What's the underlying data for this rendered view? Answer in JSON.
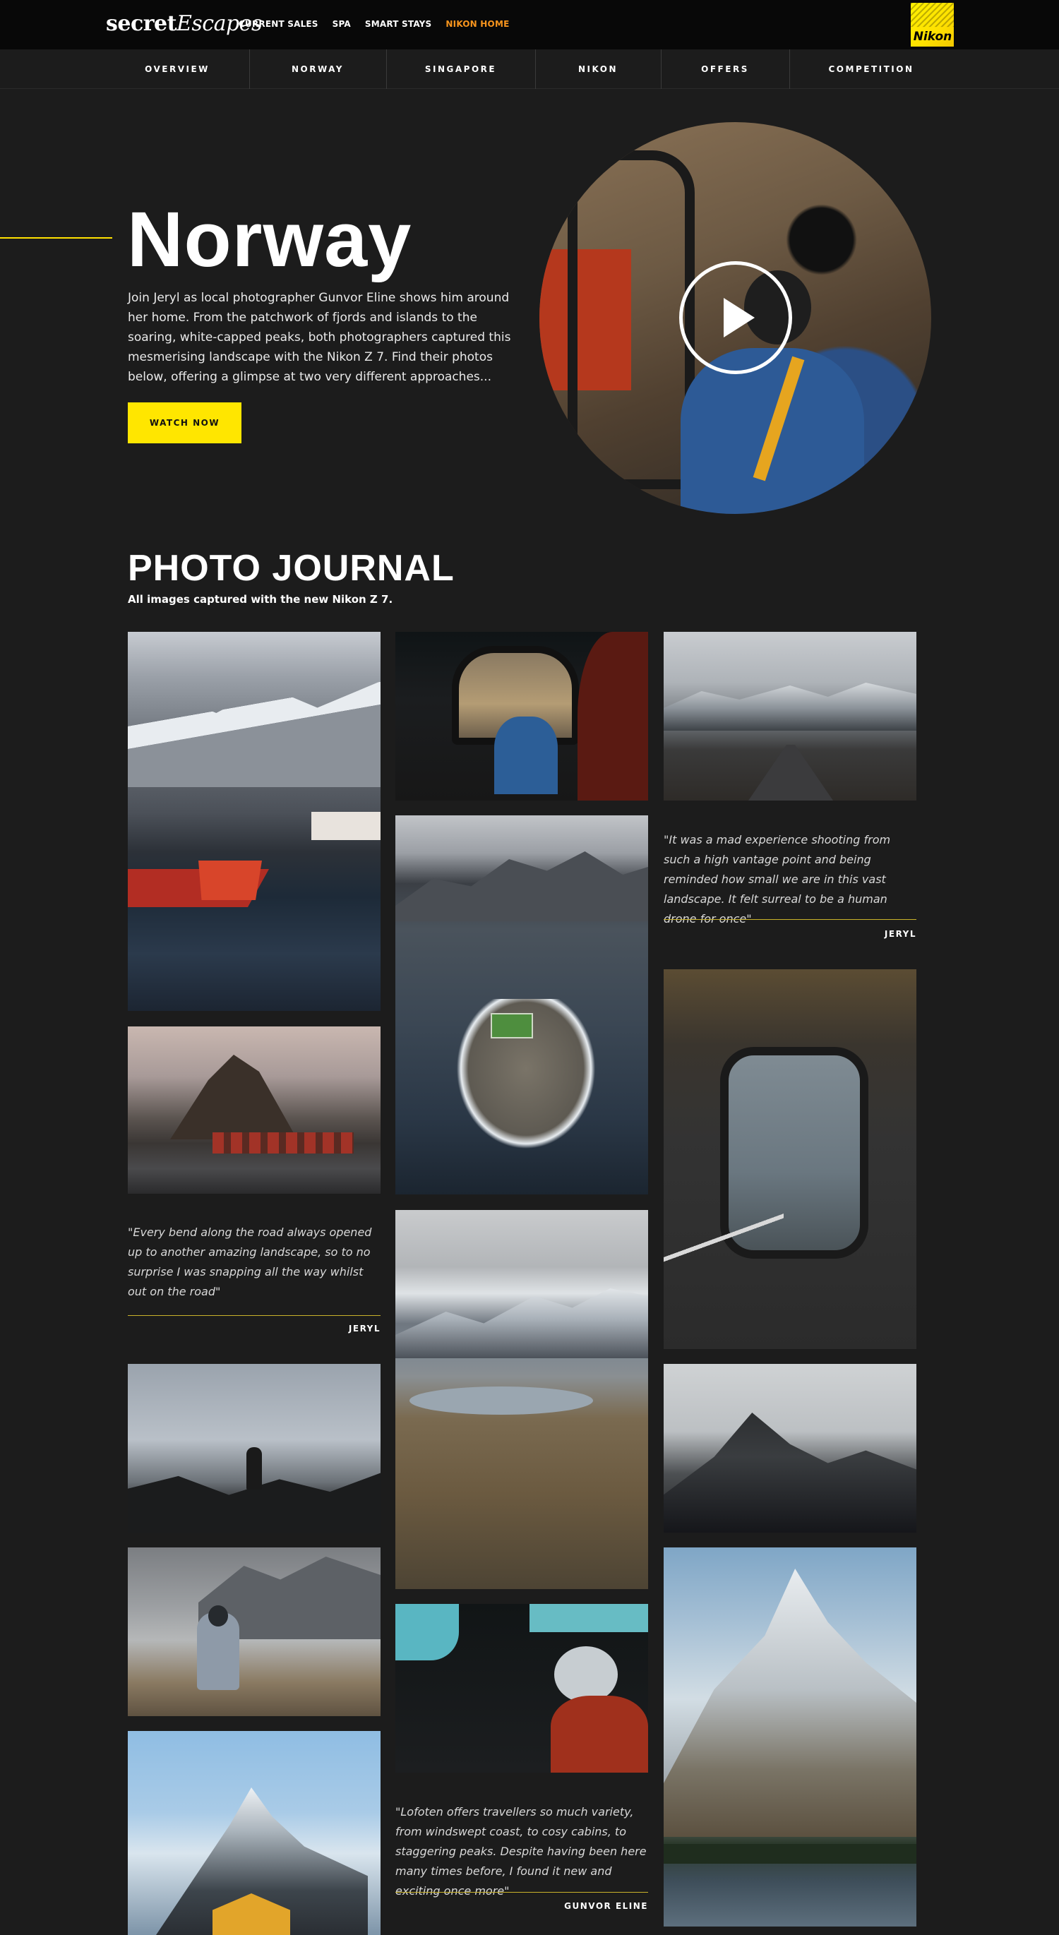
{
  "header": {
    "logo_bold": "secret",
    "logo_italic": "Escapes",
    "nav": [
      {
        "label": "CURRENT SALES"
      },
      {
        "label": "SPA"
      },
      {
        "label": "SMART STAYS"
      },
      {
        "label": "NIKON HOME",
        "active": true
      }
    ],
    "nikon_badge": "Nikon",
    "accent_color": "#f7941d"
  },
  "section_nav": [
    "OVERVIEW",
    "NORWAY",
    "SINGAPORE",
    "NIKON",
    "OFFERS",
    "COMPETITION"
  ],
  "hero": {
    "title": "Norway",
    "text": "Join Jeryl as local photographer Gunvor Eline shows him around her home. From the patchwork of fjords and islands to the soaring, white-capped peaks, both photographers captured this mesmerising landscape with the Nikon Z 7. Find their photos below, offering a glimpse at two very different approaches...",
    "button": "WATCH NOW",
    "button_color": "#ffe600",
    "play_icon": "play-icon"
  },
  "journal": {
    "title": "PHOTO JOURNAL",
    "subtitle": "All images captured with the new Nikon Z 7.",
    "quotes": [
      {
        "text": "\"It was a mad experience shooting from such a high vantage point and being reminded how small we are in this vast landscape. It felt surreal to be a human drone for once\"",
        "author": "JERYL"
      },
      {
        "text": "\"Every bend along the road always opened up to another amazing landscape, so to no surprise I was snapping all the way whilst out on the road\"",
        "author": "JERYL"
      },
      {
        "text": "\"Lofoten offers travellers so much variety, from windswept coast, to cosy cabins, to staggering peaks. Despite having been here many times before, I found it new and exciting once more\"",
        "author": "GUNVOR ELINE"
      }
    ]
  }
}
